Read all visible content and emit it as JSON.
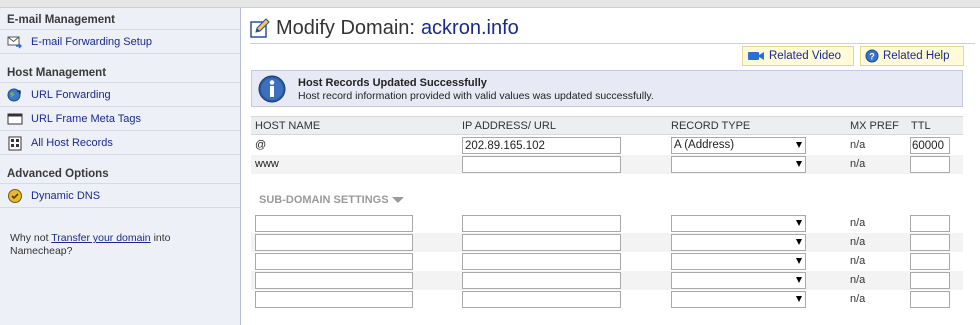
{
  "sidebar": {
    "sections": [
      {
        "title": "E-mail Management",
        "items": [
          {
            "label": "E-mail Forwarding Setup",
            "icon": "email-forward-icon"
          }
        ]
      },
      {
        "title": "Host Management",
        "items": [
          {
            "label": "URL Forwarding",
            "icon": "globe-icon"
          },
          {
            "label": "URL Frame Meta Tags",
            "icon": "frame-icon"
          },
          {
            "label": "All Host Records",
            "icon": "host-records-icon"
          }
        ]
      },
      {
        "title": "Advanced Options",
        "items": [
          {
            "label": "Dynamic DNS",
            "icon": "dynamic-dns-icon"
          }
        ]
      }
    ],
    "note_prefix": "Why not ",
    "note_link": "Transfer your domain",
    "note_suffix": " into",
    "note_line2": "Namecheap?"
  },
  "page": {
    "title": "Modify Domain:",
    "domain": "ackron.info",
    "related_video": "Related Video",
    "related_help": "Related Help"
  },
  "notice": {
    "title": "Host Records Updated Successfully",
    "message": "Host record information provided with valid values was updated successfully."
  },
  "table": {
    "columns": [
      "HOST NAME",
      "IP ADDRESS/ URL",
      "RECORD TYPE",
      "MX PREF",
      "TTL"
    ],
    "rows": [
      {
        "host": "@",
        "ip": "202.89.165.102",
        "type": "A (Address)",
        "mx": "n/a",
        "ttl": "60000"
      },
      {
        "host": "www",
        "ip": "",
        "type": "",
        "mx": "n/a",
        "ttl": ""
      }
    ]
  },
  "subdomain": {
    "title": "SUB-DOMAIN SETTINGS",
    "rows": [
      {
        "host": "",
        "ip": "",
        "type": "",
        "mx": "n/a",
        "ttl": ""
      },
      {
        "host": "",
        "ip": "",
        "type": "",
        "mx": "n/a",
        "ttl": ""
      },
      {
        "host": "",
        "ip": "",
        "type": "",
        "mx": "n/a",
        "ttl": ""
      },
      {
        "host": "",
        "ip": "",
        "type": "",
        "mx": "n/a",
        "ttl": ""
      },
      {
        "host": "",
        "ip": "",
        "type": "",
        "mx": "n/a",
        "ttl": ""
      }
    ]
  },
  "colors": {
    "link": "#1a2a8a",
    "sidebar_bg": "#eef0f8",
    "notice_bg": "#e7e9f5",
    "help_btn_bg": "#fffbd9"
  }
}
